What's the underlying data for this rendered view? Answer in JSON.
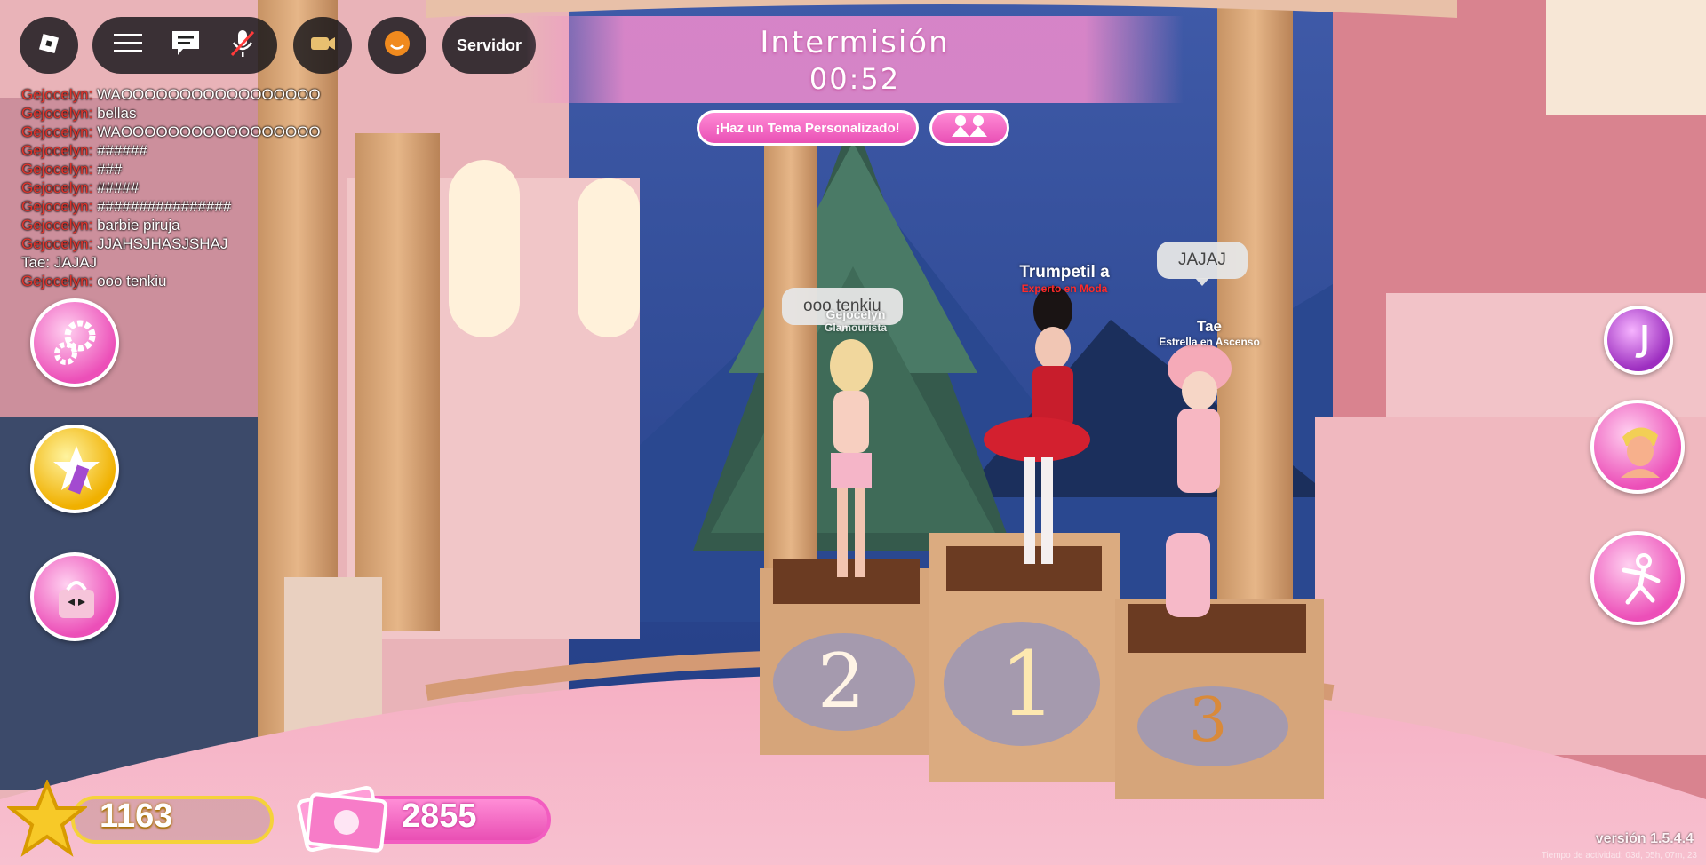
{
  "topbar": {
    "server_label": "Servidor"
  },
  "banner": {
    "title": "Intermisión",
    "timer": "00:52",
    "custom_theme_label": "¡Haz un Tema Personalizado!"
  },
  "chat": {
    "messages": [
      {
        "name": "Gejocelyn:",
        "text": "WAOOOOOOOOOOOOOOOOO"
      },
      {
        "name": "Gejocelyn:",
        "text": "bellas"
      },
      {
        "name": "Gejocelyn:",
        "text": "WAOOOOOOOOOOOOOOOOO"
      },
      {
        "name": "Gejocelyn:",
        "text": "######"
      },
      {
        "name": "Gejocelyn:",
        "text": "###"
      },
      {
        "name": "Gejocelyn:",
        "text": "#####"
      },
      {
        "name": "Gejocelyn:",
        "text": "################"
      },
      {
        "name": "Gejocelyn:",
        "text": "barbie piruja"
      },
      {
        "name": "Gejocelyn:",
        "text": "JJAHSJHASJSHAJ"
      },
      {
        "name": "Tae:",
        "text": "JAJAJ"
      },
      {
        "name": "Gejocelyn:",
        "text": "ooo tenkiu"
      }
    ]
  },
  "currency": {
    "stars": "1163",
    "money": "2855"
  },
  "podium": {
    "labels": [
      "2",
      "1",
      "3"
    ],
    "second": {
      "name": "Gejocelyn",
      "title": "Glamourista",
      "bubble": "ooo tenkiu"
    },
    "first": {
      "name": "Trumpetil a",
      "title": "Experto en Moda"
    },
    "third": {
      "name": "Tae",
      "title": "Estrella en Ascenso",
      "bubble": "JAJAJ"
    }
  },
  "footer": {
    "version": "versión 1.5.4.4",
    "activity": "Tiempo de actividad: 03d, 05h, 07m, 23"
  },
  "colors": {
    "accent_pink": "#ec4fb8",
    "chat_name_red": "#e0342c",
    "star_gold": "#f5d23a"
  },
  "icons": [
    "roblox-logo-icon",
    "menu-icon",
    "chat-icon",
    "mic-muted-icon",
    "camera-icon",
    "emote-icon",
    "settings-icon",
    "styles-icon",
    "shop-icon",
    "profile-icon",
    "avatar-icon",
    "pose-icon",
    "star-icon",
    "money-icon",
    "vote-icon"
  ]
}
